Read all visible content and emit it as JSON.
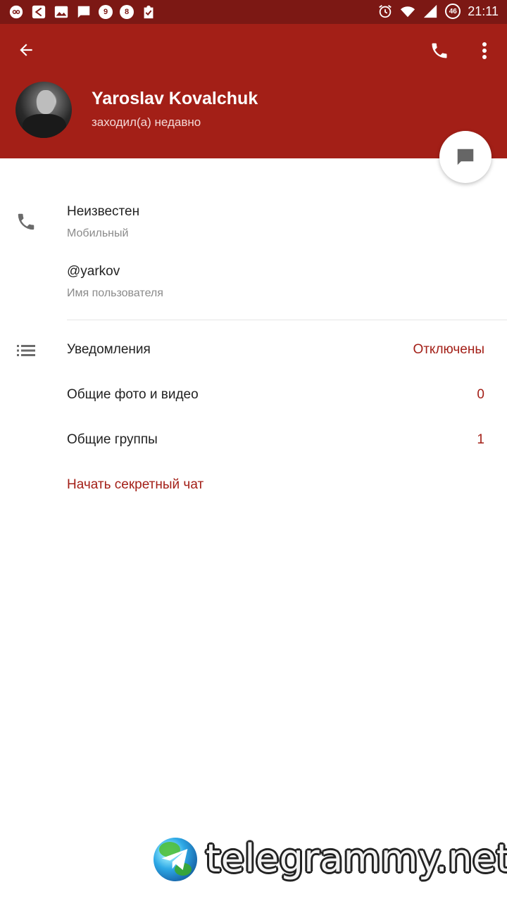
{
  "status_bar": {
    "time": "21:11",
    "notifications": [
      "infinity-icon",
      "share-icon",
      "image-icon",
      "message-icon",
      "9",
      "8",
      "clipboard-check-icon"
    ],
    "badge_9": "9",
    "badge_8": "8",
    "battery_level": "46"
  },
  "header": {
    "name": "Yaroslav Kovalchuk",
    "status": "заходил(а) недавно",
    "accent_color": "#a31f17"
  },
  "info": {
    "phone_value": "Неизвестен",
    "phone_label": "Мобильный",
    "username_value": "@yarkov",
    "username_label": "Имя пользователя"
  },
  "settings": {
    "notifications_label": "Уведомления",
    "notifications_value": "Отключены",
    "shared_media_label": "Общие фото и видео",
    "shared_media_value": "0",
    "shared_groups_label": "Общие группы",
    "shared_groups_value": "1",
    "secret_chat_label": "Начать секретный чат"
  },
  "watermark": {
    "text": "telegrammy.net"
  }
}
